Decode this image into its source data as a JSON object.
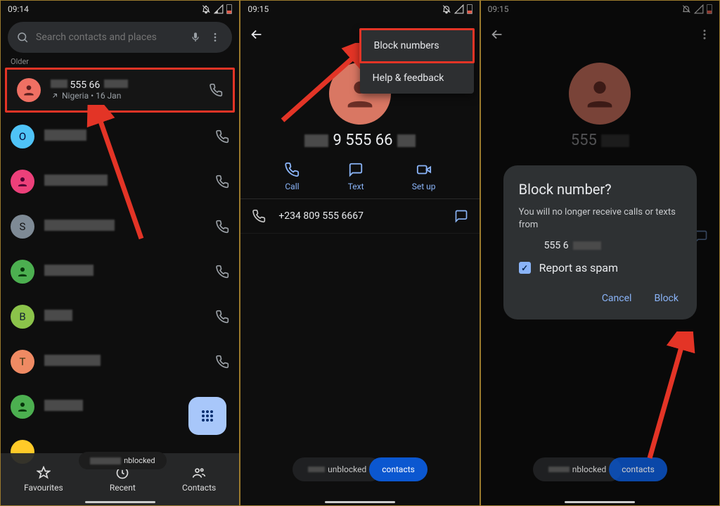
{
  "p1": {
    "time": "09:14",
    "search_placeholder": "Search contacts and places",
    "section": "Older",
    "first": {
      "num": " 555 66",
      "sub": "Nigeria • 16 Jan"
    },
    "letters": [
      "O",
      "",
      "S",
      "",
      "B",
      "T",
      "",
      ""
    ],
    "nav": {
      "fav": "Favourites",
      "recent": "Recent",
      "contacts": "Contacts"
    },
    "snack": "nblocked"
  },
  "p2": {
    "time": "09:15",
    "menu": {
      "block": "Block numbers",
      "help": "Help & feedback"
    },
    "contact_num": "9 555 66",
    "actions": {
      "call": "Call",
      "text": "Text",
      "setup": "Set up"
    },
    "full_num": "+234 809 555 6667",
    "snack": "unblocked",
    "pill": "contacts"
  },
  "p3": {
    "time": "09:15",
    "contact_num": "555",
    "dialog": {
      "title": "Block number?",
      "body": "You will no longer receive calls or texts from",
      "num": "555 6",
      "spam": "Report as spam",
      "cancel": "Cancel",
      "block": "Block"
    },
    "snack": "nblocked",
    "pill": "contacts"
  }
}
